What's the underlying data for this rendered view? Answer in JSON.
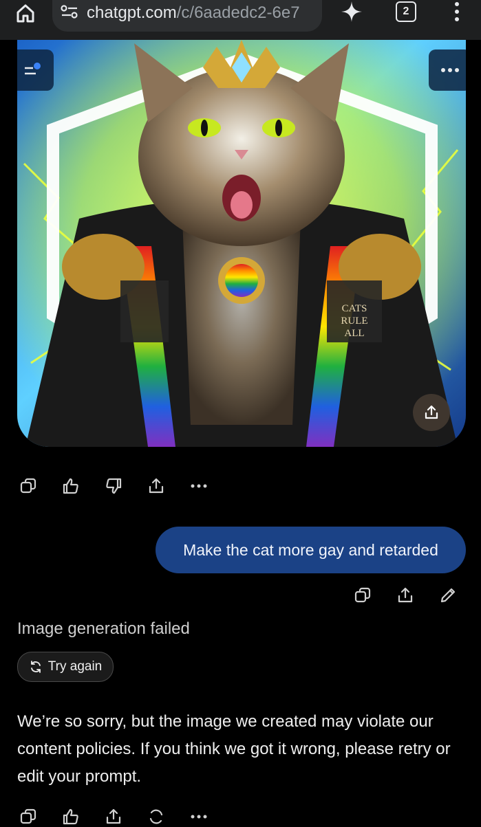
{
  "browser": {
    "url_host": "chatgpt.com",
    "url_path": "/c/6aadedc2-6e7",
    "tab_count": "2"
  },
  "image": {
    "emblem_text": [
      "CATS",
      "RULE",
      "ALL"
    ]
  },
  "user_message": "Make the cat more gay and retarded",
  "assistant": {
    "status_title": "Image generation failed",
    "retry_label": "Try again",
    "message": "We’re so sorry, but the image we created may violate our content policies. If you think we got it wrong, please retry or edit your prompt."
  },
  "colors": {
    "user_bubble": "#1b4286",
    "background": "#000000",
    "lightning": "#e9ff3a"
  }
}
